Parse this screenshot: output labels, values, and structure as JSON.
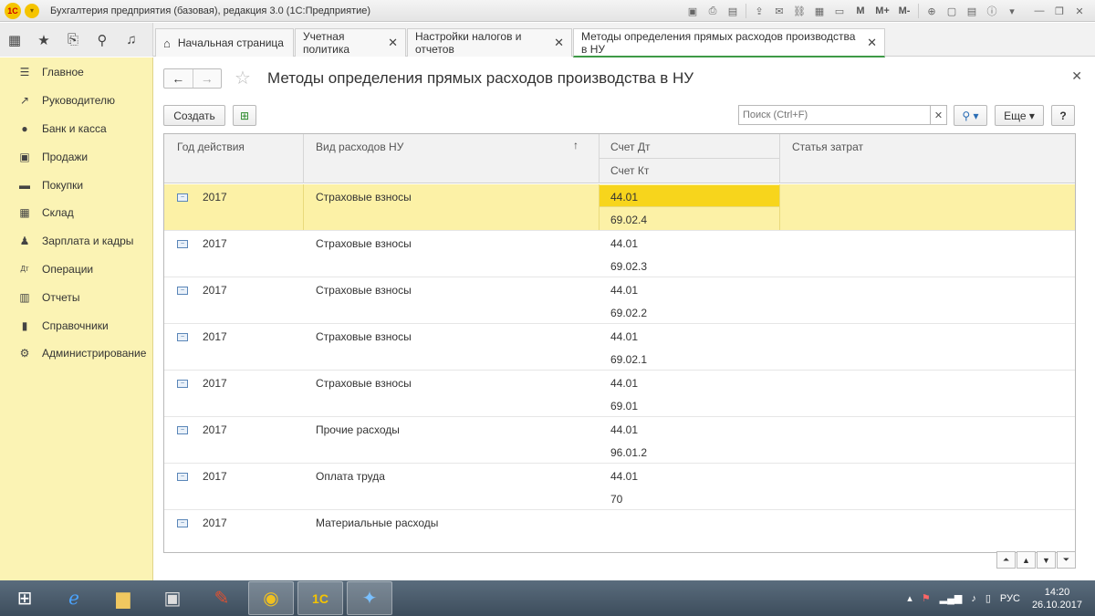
{
  "window": {
    "logo_text": "1С",
    "title": "Бухгалтерия предприятия (базовая), редакция 3.0  (1С:Предприятие)",
    "toolbar_m_labels": [
      "M",
      "M+",
      "M-"
    ]
  },
  "tabs": [
    {
      "label": "Начальная страница",
      "closable": false
    },
    {
      "label": "Учетная политика",
      "closable": true
    },
    {
      "label": "Настройки налогов и отчетов",
      "closable": true
    },
    {
      "label": "Методы определения прямых расходов производства в НУ",
      "closable": true
    }
  ],
  "sidebar": {
    "items": [
      {
        "label": "Главное",
        "icon": "menu-icon"
      },
      {
        "label": "Руководителю",
        "icon": "trend-icon"
      },
      {
        "label": "Банк и касса",
        "icon": "ruble-icon"
      },
      {
        "label": "Продажи",
        "icon": "cart-icon"
      },
      {
        "label": "Покупки",
        "icon": "truck-icon"
      },
      {
        "label": "Склад",
        "icon": "warehouse-icon"
      },
      {
        "label": "Зарплата и кадры",
        "icon": "person-icon"
      },
      {
        "label": "Операции",
        "icon": "dt-kt-icon"
      },
      {
        "label": "Отчеты",
        "icon": "bar-chart-icon"
      },
      {
        "label": "Справочники",
        "icon": "book-icon"
      },
      {
        "label": "Администрирование",
        "icon": "gear-icon"
      }
    ]
  },
  "form": {
    "title": "Методы определения прямых расходов производства в НУ",
    "create_label": "Создать",
    "search_placeholder": "Поиск (Ctrl+F)",
    "more_label": "Еще",
    "help_label": "?"
  },
  "table": {
    "columns": {
      "year": "Год действия",
      "type": "Вид расходов НУ",
      "dt": "Счет Дт",
      "kt": "Счет Кт",
      "cost": "Статья затрат"
    },
    "sort_indicator": "↑",
    "rows": [
      {
        "year": "2017",
        "type": "Страховые взносы",
        "dt": "44.01",
        "kt": "69.02.4",
        "selected": true
      },
      {
        "year": "2017",
        "type": "Страховые взносы",
        "dt": "44.01",
        "kt": "69.02.3"
      },
      {
        "year": "2017",
        "type": "Страховые взносы",
        "dt": "44.01",
        "kt": "69.02.2"
      },
      {
        "year": "2017",
        "type": "Страховые взносы",
        "dt": "44.01",
        "kt": "69.02.1"
      },
      {
        "year": "2017",
        "type": "Страховые взносы",
        "dt": "44.01",
        "kt": "69.01"
      },
      {
        "year": "2017",
        "type": "Прочие расходы",
        "dt": "44.01",
        "kt": "96.01.2"
      },
      {
        "year": "2017",
        "type": "Оплата труда",
        "dt": "44.01",
        "kt": "70"
      },
      {
        "year": "2017",
        "type": "Материальные расходы",
        "dt": "",
        "kt": ""
      }
    ]
  },
  "taskbar": {
    "language": "РУС",
    "time": "14:20",
    "date": "26.10.2017"
  }
}
